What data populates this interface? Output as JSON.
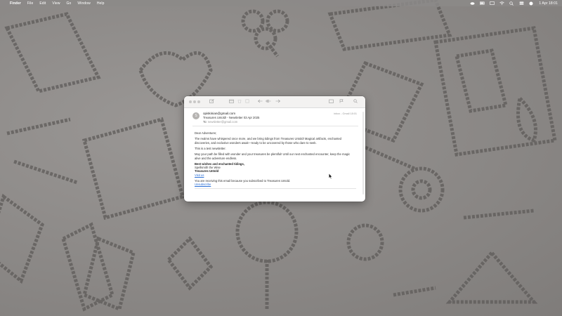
{
  "menubar": {
    "apple_icon": "apple-icon",
    "items": [
      "Finder",
      "File",
      "Edit",
      "View",
      "Go",
      "Window",
      "Help"
    ],
    "clock": "1 Apr 18:01"
  },
  "mail": {
    "avatar_letter": "S",
    "from": "opiskinian@gmail.com",
    "subject": "Treasures Untold! - Newsletter 03 Apr 2025",
    "to_label": "To:",
    "to_address": "newsletter@gmail.com",
    "date_right": "inbox - Gmail  18:01",
    "greeting": "Dear Adventurer,",
    "para1": "The realms have whispered once more, and we bring tidings from Treasures Untold! Magical artifacts, enchanted discoveries, and exclusive wonders await—ready to be uncovered by those who dare to seek.",
    "para2": "This is a test newsletter.",
    "para3": "May your path be filled with wonder and your treasures be plentiful! Until our next enchanted encounter, keep the magic alive and the adventure endless.",
    "sign_1": "Best wishes and enchanted tidings,",
    "sign_2": "Spellsmith the Wise",
    "sign_3": "Treasures Untold",
    "sign_link": "Visit us",
    "footer": "You are receiving this email because you subscribed to Treasures Untold.",
    "unsubscribe": "Unsubscribe"
  }
}
